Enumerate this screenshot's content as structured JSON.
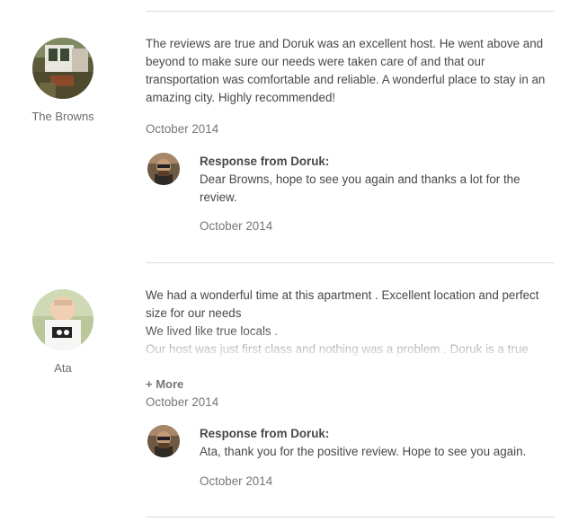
{
  "reviews": [
    {
      "reviewer": "The Browns",
      "text": "The reviews are true and Doruk was an excellent host. He went above and beyond to make sure our needs were taken care of and that our transportation was comfortable and reliable. A wonderful place to stay in an amazing city. Highly recommended!",
      "date": "October 2014",
      "response": {
        "title": "Response from Doruk:",
        "text": "Dear Browns, hope to see you again and thanks a lot for the review.",
        "date": "October 2014"
      }
    },
    {
      "reviewer": "Ata",
      "text_lines": [
        "We had a wonderful time at this apartment . Excellent location and perfect size for our needs",
        "We lived like true locals .",
        "Our host was just first class and nothing was a problem . Doruk is a true gentleman"
      ],
      "more_label": "+ More",
      "date": "October 2014",
      "response": {
        "title": "Response from Doruk:",
        "text": "Ata, thank you for the positive review. Hope to see you again.",
        "date": "October 2014"
      }
    }
  ],
  "icons": {
    "reviewer_1_avatar": "house-photo-avatar",
    "reviewer_2_avatar": "baby-photo-avatar",
    "host_avatar": "host-photo-avatar"
  }
}
